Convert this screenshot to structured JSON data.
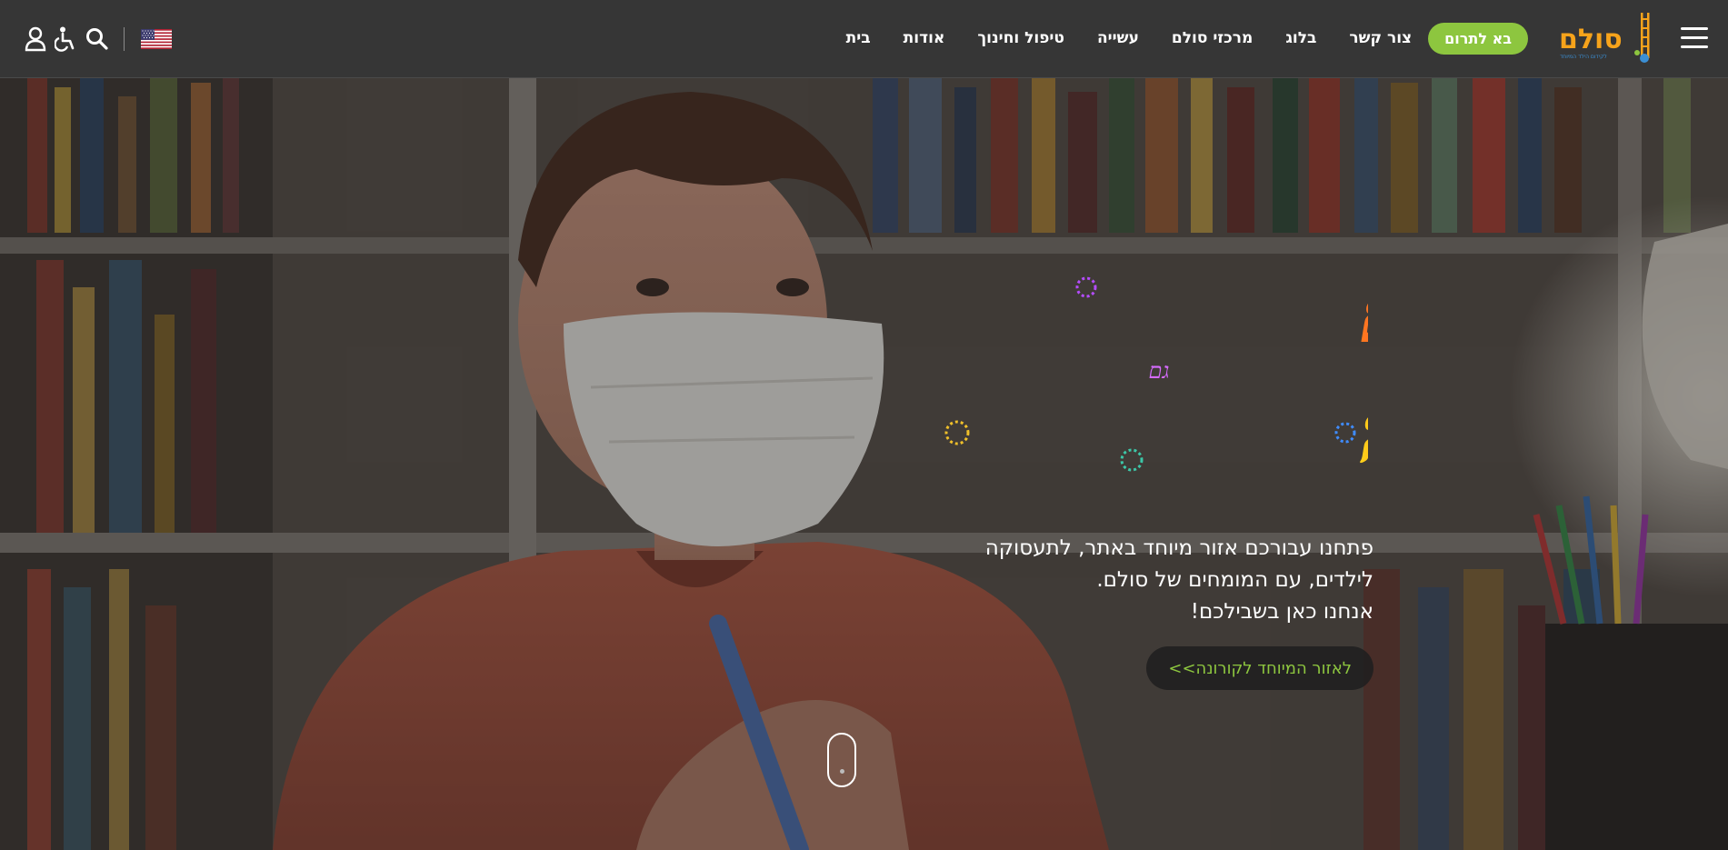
{
  "header": {
    "nav": [
      {
        "label": "בית",
        "name": "nav-home"
      },
      {
        "label": "אודות",
        "name": "nav-about"
      },
      {
        "label": "טיפול וחינוך",
        "name": "nav-treatment-education"
      },
      {
        "label": "עשייה",
        "name": "nav-activity"
      },
      {
        "label": "מרכזי סולם",
        "name": "nav-sulam-centers"
      },
      {
        "label": "בלוג",
        "name": "nav-blog"
      },
      {
        "label": "צור קשר",
        "name": "nav-contact"
      }
    ],
    "donate_label": "בא לתרום",
    "logo": {
      "text": "סולם",
      "tagline": "לקידום הילד המיוחד"
    },
    "utility_icons": [
      "user-icon",
      "accessibility-icon",
      "search-icon"
    ],
    "language_flag": "us-flag-icon"
  },
  "hero": {
    "headline": {
      "line1": "סולם איתכם",
      "connector": "גם",
      "line2": "בקורונה"
    },
    "body_lines": [
      "פתחנו עבורכם אזור מיוחד באתר, לתעסוקה",
      "לילדים, עם המומחים של סולם.",
      "אנחנו כאן בשבילכם!"
    ],
    "cta_label": "לאזור המיוחד לקורונה>>"
  },
  "colors": {
    "header_bg": "#363636",
    "accent_green": "#8dc63f",
    "text_white": "#ffffff"
  }
}
